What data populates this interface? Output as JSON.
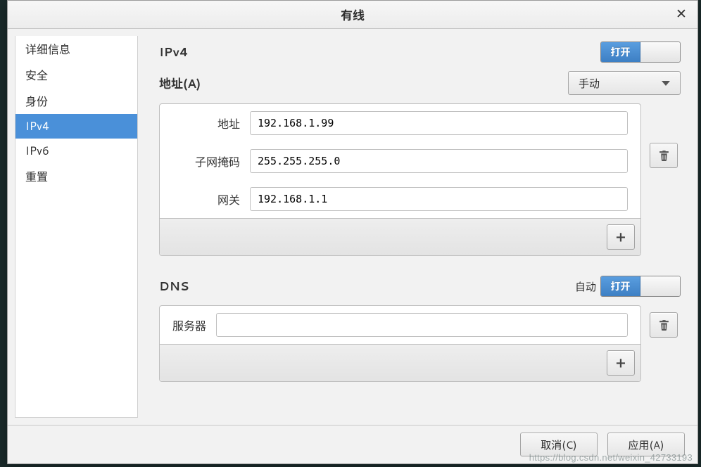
{
  "window": {
    "title": "有线"
  },
  "sidebar": {
    "items": [
      {
        "label": "详细信息",
        "selected": false
      },
      {
        "label": "安全",
        "selected": false
      },
      {
        "label": "身份",
        "selected": false
      },
      {
        "label": "IPv4",
        "selected": true
      },
      {
        "label": "IPv6",
        "selected": false
      },
      {
        "label": "重置",
        "selected": false
      }
    ]
  },
  "ipv4": {
    "heading": "IPv4",
    "toggle_on_label": "打开",
    "address_section_label": "地址(A)",
    "mode_selected": "手动",
    "fields": {
      "address_label": "地址",
      "address_value": "192.168.1.99",
      "netmask_label": "子网掩码",
      "netmask_value": "255.255.255.0",
      "gateway_label": "网关",
      "gateway_value": "192.168.1.1"
    }
  },
  "dns": {
    "heading": "DNS",
    "auto_label": "自动",
    "toggle_on_label": "打开",
    "server_label": "服务器",
    "server_value": ""
  },
  "footer": {
    "cancel": "取消(C)",
    "apply": "应用(A)"
  },
  "watermark": "https://blog.csdn.net/weixin_42733193"
}
